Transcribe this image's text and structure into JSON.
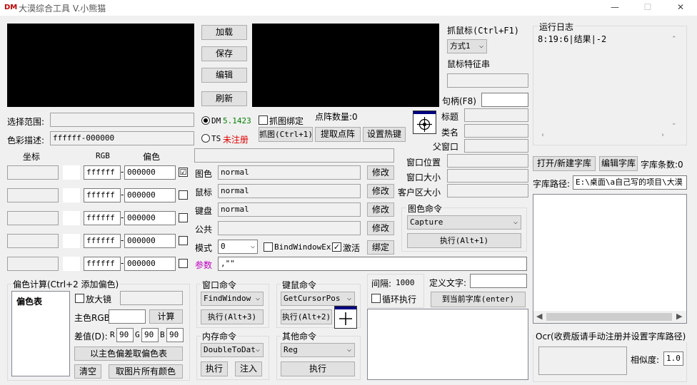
{
  "window": {
    "logo": "DM",
    "title": "大漠综合工具 V.小熊猫",
    "min": "—",
    "max": "☐",
    "close": "✕"
  },
  "top_buttons": [
    "加载",
    "保存",
    "编辑",
    "刷新"
  ],
  "capture": {
    "mouse_label": "抓鼠标(Ctrl+F1)",
    "mode": "方式1",
    "feature_label": "鼠标特征串",
    "handle_label": "句柄(F8)",
    "title_label": "标题",
    "class_label": "类名",
    "parent_label": "父窗口",
    "winpos_label": "窗口位置",
    "winsize_label": "窗口大小",
    "client_label": "客户区大小"
  },
  "range": {
    "select_label": "选择范围:",
    "desc_label": "色彩描述:",
    "desc_value": "ffffff-000000"
  },
  "plugin": {
    "dm_label": "DM",
    "dm_version": "5.1423",
    "ts_label": "TS",
    "ts_status": "未注册",
    "bind_capture_label": "抓图绑定",
    "point_count": "点阵数量:0",
    "capture_btn": "抓图(Ctrl+1)",
    "extract_btn": "提取点阵",
    "hotkey_btn": "设置热键"
  },
  "color_table": {
    "coord_header": "坐标",
    "rgb_header": "RGB",
    "offset_header": "偏色",
    "rows": [
      {
        "rgb": "ffffff",
        "offset": "000000",
        "checked": "☑"
      },
      {
        "rgb": "ffffff",
        "offset": "000000",
        "checked": ""
      },
      {
        "rgb": "ffffff",
        "offset": "000000",
        "checked": ""
      },
      {
        "rgb": "ffffff",
        "offset": "000000",
        "checked": ""
      },
      {
        "rgb": "ffffff",
        "offset": "000000",
        "checked": ""
      }
    ]
  },
  "bind": {
    "rows": [
      {
        "label": "图色",
        "value": "normal",
        "btn": "修改"
      },
      {
        "label": "鼠标",
        "value": "normal",
        "btn": "修改"
      },
      {
        "label": "键盘",
        "value": "normal",
        "btn": "修改"
      },
      {
        "label": "公共",
        "value": "",
        "btn": "修改"
      }
    ],
    "mode_label": "模式",
    "mode_value": "0",
    "bindex_label": "BindWindowEx",
    "activate_label": "激活",
    "bind_btn": "绑定",
    "params_label": "参数",
    "params_value": ",\"\""
  },
  "color_cmd": {
    "title": "图色命令",
    "value": "Capture",
    "exec": "执行(Alt+1)"
  },
  "offset_calc": {
    "title": "偏色计算(Ctrl+2 添加偏色)",
    "table_header": "偏色表",
    "magnifier": "放大镜",
    "main_rgb": "主色RGB",
    "calc_btn": "计算",
    "diff_label": "差值(D):",
    "r_label": "R",
    "r_value": "90",
    "g_label": "G",
    "g_value": "90",
    "b_label": "B",
    "b_value": "90",
    "take_btn": "以主色偏差取偏色表",
    "clear_btn": "清空",
    "all_colors_btn": "取图片所有颜色"
  },
  "window_cmd": {
    "title": "窗口命令",
    "value": "FindWindow",
    "exec": "执行(Alt+3)"
  },
  "mouse_cmd": {
    "title": "键鼠命令",
    "value": "GetCursorPos",
    "exec": "执行(Alt+2)"
  },
  "memory_cmd": {
    "title": "内存命令",
    "value": "DoubleToDat",
    "exec": "执行",
    "inject": "注入"
  },
  "other_cmd": {
    "title": "其他命令",
    "value": "Reg",
    "exec": "执行"
  },
  "timer": {
    "interval_label": "间隔:",
    "interval_value": "1000",
    "loop_label": "循环执行",
    "define_label": "定义文字:",
    "to_lib_btn": "到当前字库(enter)"
  },
  "log": {
    "title": "运行日志",
    "line": "8:19:6|结果|-2"
  },
  "library": {
    "open_btn": "打开/新建字库",
    "edit_btn": "编辑字库",
    "count": "字库条数:0",
    "path_label": "字库路径:",
    "path_value": "E:\\桌面\\a自己写的项目\\大漠"
  },
  "ocr": {
    "title": "Ocr(收费版请手动注册并设置字库路径)",
    "similarity_label": "相似度:",
    "similarity_value": "1.0"
  }
}
